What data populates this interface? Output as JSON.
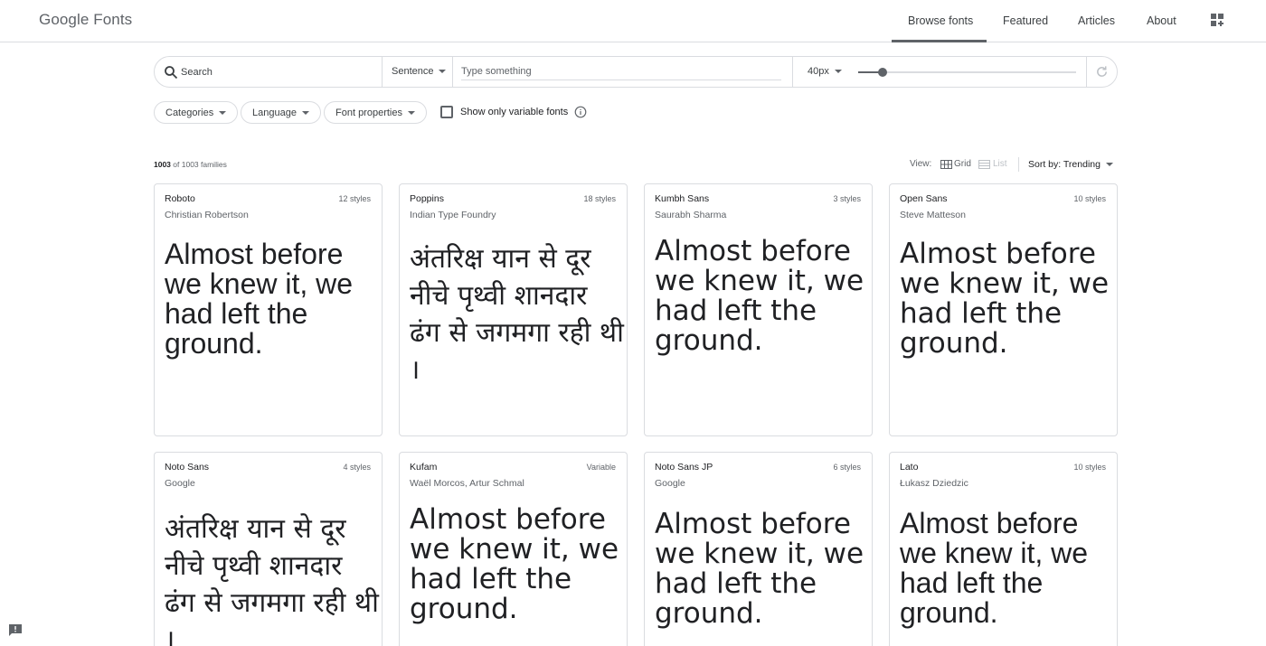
{
  "header": {
    "logo_google": "Google",
    "logo_fonts": "Fonts",
    "nav": [
      "Browse fonts",
      "Featured",
      "Articles",
      "About"
    ],
    "apps_icon": "apps-add-icon"
  },
  "toolbar": {
    "search_placeholder": "Search",
    "preview_mode": "Sentence",
    "type_placeholder": "Type something",
    "font_size": "40px",
    "font_size_slider_fraction": 0.11,
    "refresh_icon": "refresh-icon"
  },
  "filters": {
    "categories": "Categories",
    "language": "Language",
    "font_properties": "Font properties",
    "variable_label": "Show only variable fonts",
    "variable_checked": false
  },
  "results": {
    "count_shown": "1003",
    "count_suffix": " of 1003 families",
    "view_label": "View:",
    "grid_label": "Grid",
    "list_label": "List",
    "sort_label": "Sort by: Trending"
  },
  "cards": [
    {
      "name": "Roboto",
      "styles": "12 styles",
      "author": "Christian Robertson",
      "sample": "Almost before we knew it, we had left the ground."
    },
    {
      "name": "Poppins",
      "styles": "18 styles",
      "author": "Indian Type Foundry",
      "sample": "अंतरिक्ष यान से दूर नीचे पृथ्वी शानदार ढंग से जगमगा रही थी ।"
    },
    {
      "name": "Kumbh Sans",
      "styles": "3 styles",
      "author": "Saurabh Sharma",
      "sample": "Almost before we knew it, we had left the ground."
    },
    {
      "name": "Open Sans",
      "styles": "10 styles",
      "author": "Steve Matteson",
      "sample": "Almost before we knew it, we had left the ground."
    },
    {
      "name": "Noto Sans",
      "styles": "4 styles",
      "author": "Google",
      "sample": "अंतरिक्ष यान से दूर नीचे पृथ्वी शानदार ढंग से जगमगा रही थी ।"
    },
    {
      "name": "Kufam",
      "styles": "Variable",
      "author": "Waël Morcos, Artur Schmal",
      "sample": "Almost before we knew it, we had left the ground."
    },
    {
      "name": "Noto Sans JP",
      "styles": "6 styles",
      "author": "Google",
      "sample": "Almost before we knew it, we had left the ground."
    },
    {
      "name": "Lato",
      "styles": "10 styles",
      "author": "Łukasz Dziedzic",
      "sample": "Almost before we knew it, we had left the ground."
    }
  ],
  "colors": {
    "accent": "#5f6368",
    "border": "#dadce0",
    "text": "#202124"
  }
}
